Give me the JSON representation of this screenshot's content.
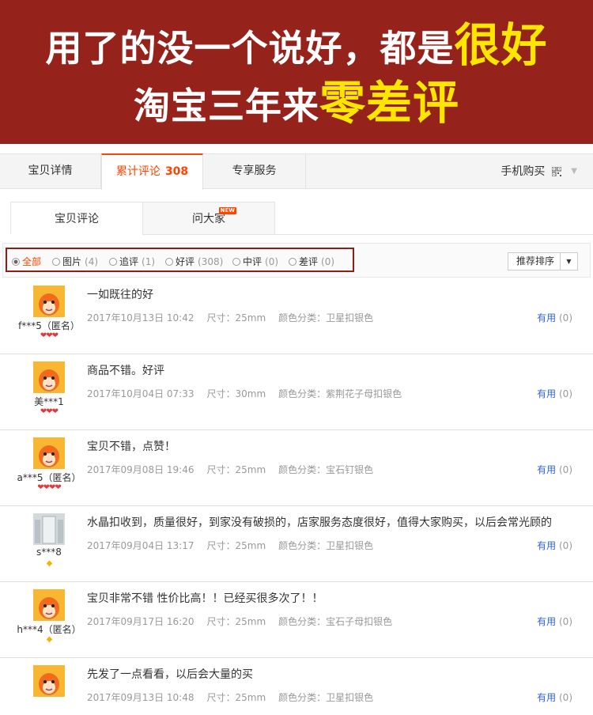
{
  "banner": {
    "line1_a": "用了的没一个说好，都是",
    "line1_hl": "很好",
    "line2_a": "淘宝三年来",
    "line2_hl": "零差评"
  },
  "tabs": [
    {
      "label": "宝贝详情"
    },
    {
      "label": "累计评论",
      "count": "308"
    },
    {
      "label": "专享服务"
    }
  ],
  "mobile_buy": "手机购买",
  "subtabs": [
    {
      "label": "宝贝评论"
    },
    {
      "label": "问大家",
      "badge": "NEW"
    }
  ],
  "filters": [
    {
      "label": "全部",
      "count": ""
    },
    {
      "label": "图片",
      "count": "(4)"
    },
    {
      "label": "追评",
      "count": "(1)"
    },
    {
      "label": "好评",
      "count": "(308)"
    },
    {
      "label": "中评",
      "count": "(0)"
    },
    {
      "label": "差评",
      "count": "(0)"
    }
  ],
  "sort_label": "推荐排序",
  "reviews": [
    {
      "user": "f***5（匿名）",
      "badge": "❤❤❤",
      "text": "一如既往的好",
      "date": "2017年10月13日 10:42",
      "size": "尺寸：25mm",
      "color": "颜色分类：卫星扣银色",
      "useful": "有用",
      "useful_count": "(0)"
    },
    {
      "user": "美***1",
      "badge": "❤❤❤",
      "text": "商品不错。好评",
      "date": "2017年10月04日 07:33",
      "size": "尺寸：30mm",
      "color": "颜色分类：紫荆花子母扣银色",
      "useful": "有用",
      "useful_count": "(0)"
    },
    {
      "user": "a***5（匿名）",
      "badge": "❤❤❤❤",
      "text": "宝贝不错，点赞！",
      "date": "2017年09月08日 19:46",
      "size": "尺寸：25mm",
      "color": "颜色分类：宝石钉银色",
      "useful": "有用",
      "useful_count": "(0)"
    },
    {
      "user": "s***8",
      "badge": "◆",
      "text": "水晶扣收到，质量很好，到家没有破损的，店家服务态度很好，值得大家购买，以后会常光顾的",
      "date": "2017年09月04日 13:17",
      "size": "尺寸：25mm",
      "color": "颜色分类：卫星扣银色",
      "useful": "有用",
      "useful_count": "(0)"
    },
    {
      "user": "h***4（匿名）",
      "badge": "◆",
      "text": "宝贝非常不错 性价比高！！已经买很多次了！！",
      "date": "2017年09月17日 16:20",
      "size": "尺寸：25mm",
      "color": "颜色分类：宝石子母扣银色",
      "useful": "有用",
      "useful_count": "(0)"
    },
    {
      "user": "",
      "badge": "",
      "text": "先发了一点看看，以后会大量的买",
      "date": "2017年09月13日 10:48",
      "size": "尺寸：25mm",
      "color": "颜色分类：卫星扣银色",
      "useful": "有用",
      "useful_count": "(0)"
    }
  ]
}
